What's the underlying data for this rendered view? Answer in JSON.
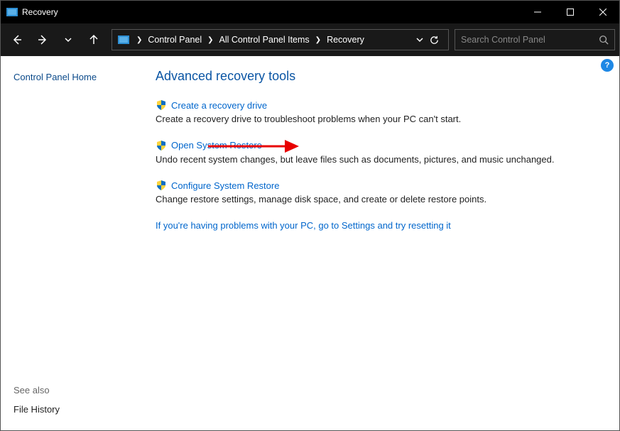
{
  "window": {
    "title": "Recovery"
  },
  "breadcrumbs": {
    "items": [
      "Control Panel",
      "All Control Panel Items",
      "Recovery"
    ]
  },
  "search": {
    "placeholder": "Search Control Panel"
  },
  "sidebar": {
    "home": "Control Panel Home",
    "see_also_label": "See also",
    "see_also_link": "File History"
  },
  "main": {
    "heading": "Advanced recovery tools",
    "tools": [
      {
        "link": "Create a recovery drive",
        "desc": "Create a recovery drive to troubleshoot problems when your PC can't start."
      },
      {
        "link": "Open System Restore",
        "desc": "Undo recent system changes, but leave files such as documents, pictures, and music unchanged."
      },
      {
        "link": "Configure System Restore",
        "desc": "Change restore settings, manage disk space, and create or delete restore points."
      }
    ],
    "extra_link": "If you're having problems with your PC, go to Settings and try resetting it"
  },
  "help": {
    "glyph": "?"
  }
}
